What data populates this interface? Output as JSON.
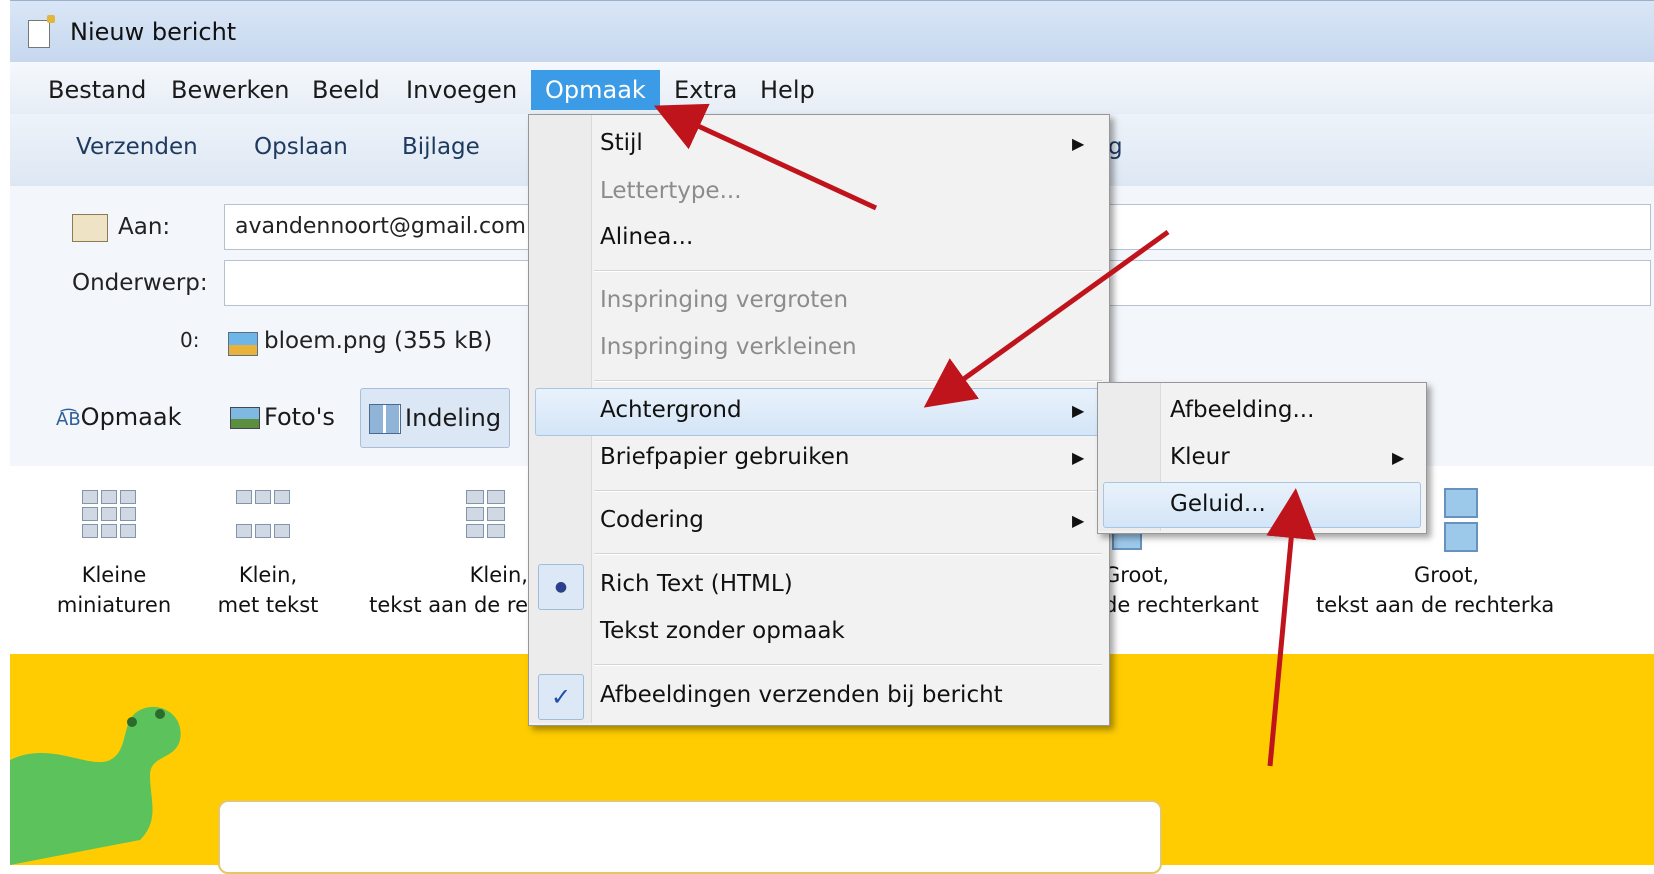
{
  "window": {
    "title": "Nieuw bericht"
  },
  "menubar": {
    "items": [
      "Bestand",
      "Bewerken",
      "Beeld",
      "Invoegen",
      "Opmaak",
      "Extra",
      "Help"
    ],
    "active": "Opmaak"
  },
  "toolbar": {
    "send": "Verzenden",
    "save": "Opslaan",
    "attach": "Bijlage",
    "partial": "g"
  },
  "header": {
    "to_label": "Aan:",
    "to_value": "avandennoort@gmail.com",
    "subject_label": "Onderwerp:",
    "subject_value": "",
    "attachment_symbol": "0:",
    "attachment": "bloem.png (355 kB)"
  },
  "tabs": {
    "format": "Opmaak",
    "photos": "Foto's",
    "layout": "Indeling",
    "format_icon": "A͡B"
  },
  "gallery": {
    "items": [
      {
        "line1": "Kleine",
        "line2": "miniaturen"
      },
      {
        "line1": "Klein,",
        "line2": "met tekst"
      },
      {
        "line1": "Klein,",
        "line2": "tekst aan de re"
      },
      {
        "line1": "Groot,",
        "line2": "de rechterkant"
      },
      {
        "line1": "Groot,",
        "line2": "tekst aan de rechterka"
      }
    ]
  },
  "format_menu": {
    "style": "Stijl",
    "font": "Lettertype...",
    "paragraph": "Alinea...",
    "indent_increase": "Inspringing vergroten",
    "indent_decrease": "Inspringing verkleinen",
    "background": "Achtergrond",
    "stationery": "Briefpapier gebruiken",
    "encoding": "Codering",
    "rich_text": "Rich Text (HTML)",
    "plain_text": "Tekst zonder opmaak",
    "send_images": "Afbeeldingen verzenden bij bericht",
    "check_mark": "✓",
    "bullet": "●"
  },
  "background_submenu": {
    "image": "Afbeelding...",
    "color": "Kleur",
    "sound": "Geluid..."
  },
  "arrow_glyph": "▶",
  "colors": {
    "accent": "#3c9be6",
    "annotation_arrow": "#c0141c",
    "stationery_bg": "#fecc00"
  }
}
